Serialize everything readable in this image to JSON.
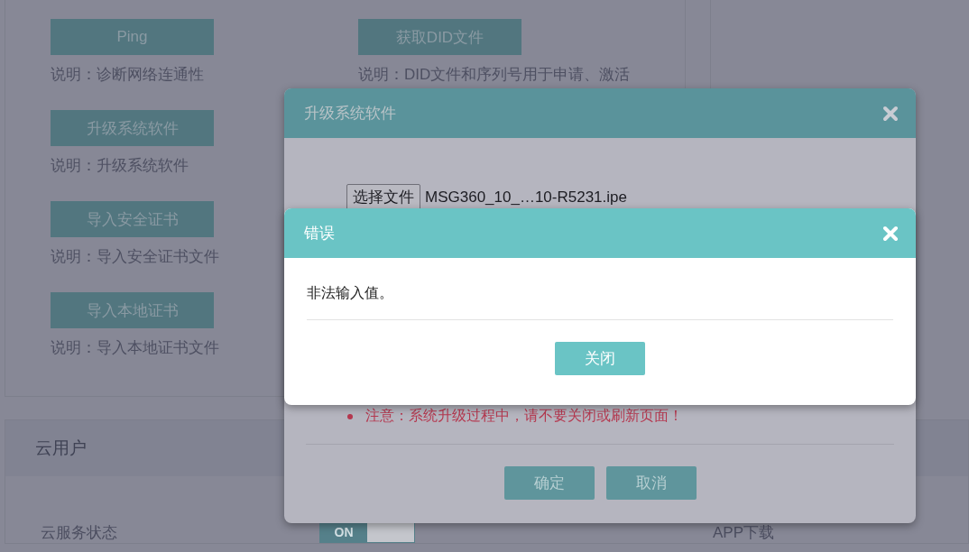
{
  "page": {
    "tool_columns": [
      [
        {
          "button": "Ping",
          "description": "说明：诊断网络连通性"
        },
        {
          "button": "升级系统软件",
          "description": "说明：升级系统软件"
        },
        {
          "button": "导入安全证书",
          "description": "说明：导入安全证书文件"
        },
        {
          "button": "导入本地证书",
          "description": "说明：导入本地证书文件"
        }
      ],
      [
        {
          "button": "获取DID文件",
          "description": "说明：DID文件和序列号用于申请、激活"
        }
      ]
    ],
    "cloud_section": {
      "title": "云用户",
      "service_status_label": "云服务状态",
      "toggle": {
        "label": "ON",
        "on": true
      },
      "app_download": "APP下载"
    }
  },
  "upgrade_dialog": {
    "title": "升级系统软件",
    "file_button": "选择文件",
    "file_name": "MSG360_10_…10-R5231.ipe",
    "note": "注意：系统升级过程中，请不要关闭或刷新页面！",
    "buttons": [
      "确定",
      "取消"
    ]
  },
  "error_dialog": {
    "title": "错误",
    "message": "非法输入值。",
    "buttons": [
      "关闭"
    ]
  }
}
